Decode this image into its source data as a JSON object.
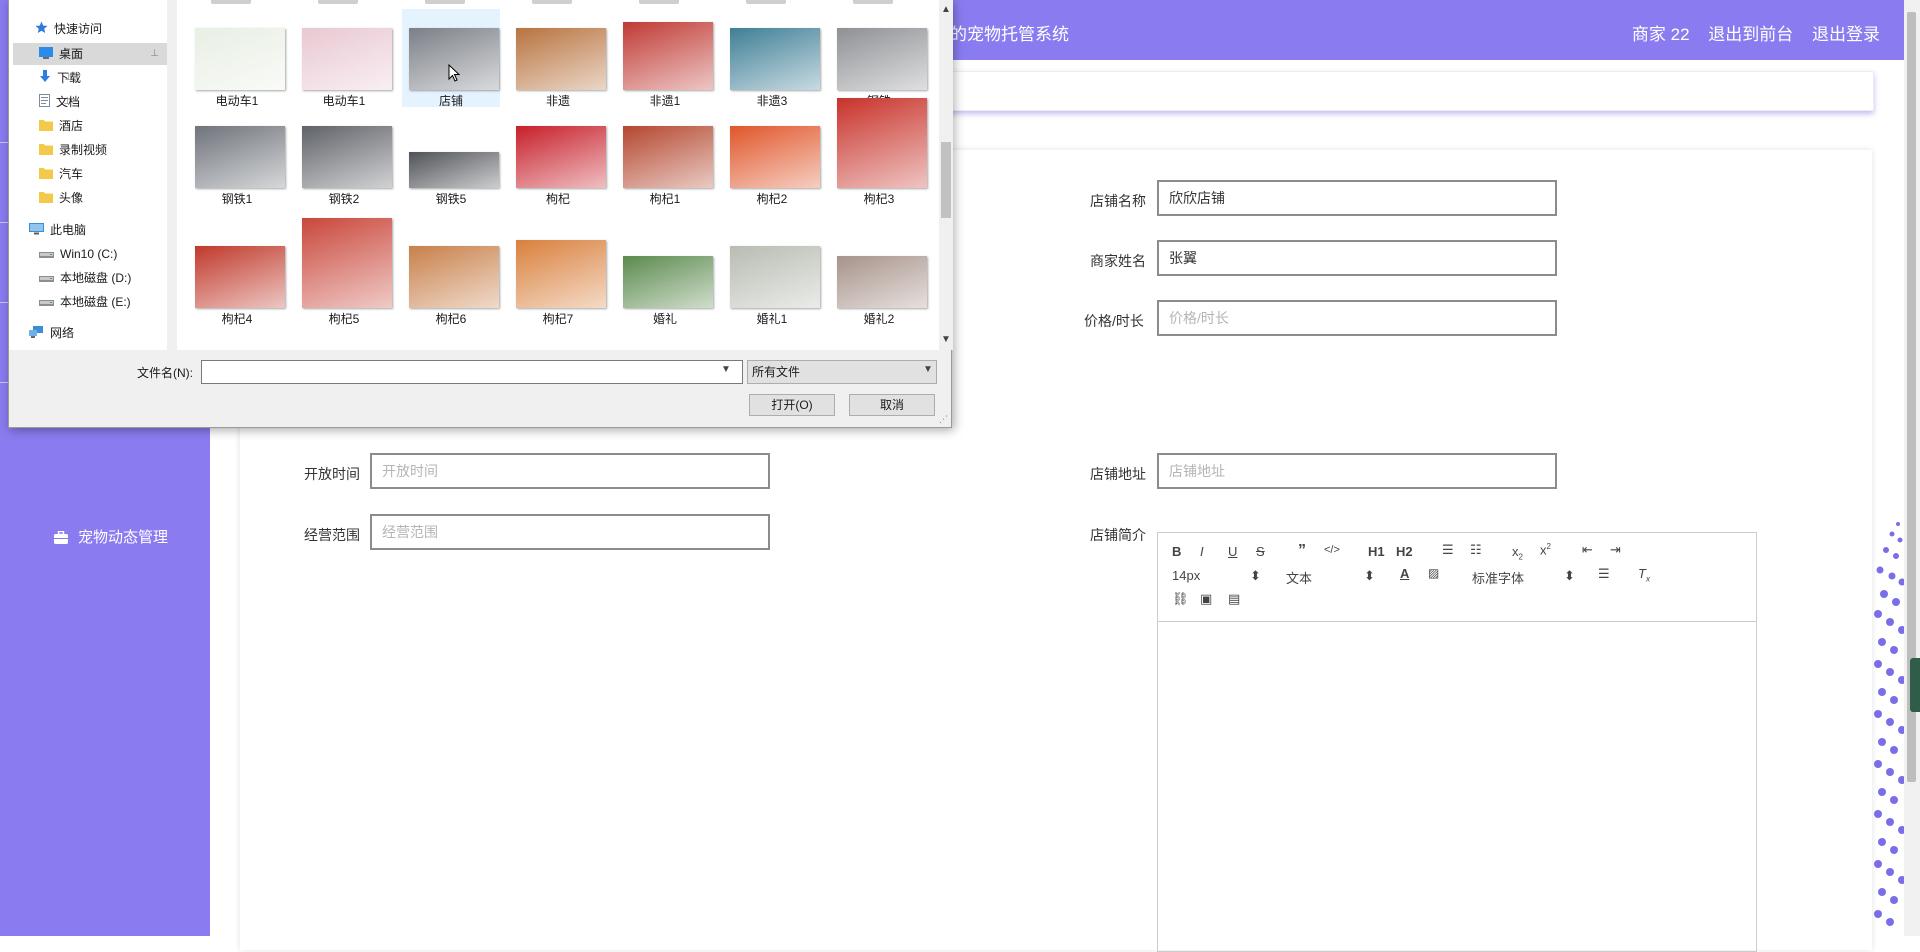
{
  "app": {
    "title": "的宠物托管系统",
    "user_label": "商家 22",
    "back_to_front": "退出到前台",
    "logout": "退出登录"
  },
  "sidebar": {
    "pet_news_item": "宠物动态管理"
  },
  "form": {
    "shop_name": {
      "label": "店铺名称",
      "value": "欣欣店铺"
    },
    "merchant_name": {
      "label": "商家姓名",
      "value": "张翼"
    },
    "price": {
      "label": "价格/时长",
      "placeholder": "价格/时长"
    },
    "open_time": {
      "label": "开放时间",
      "placeholder": "开放时间"
    },
    "address": {
      "label": "店铺地址",
      "placeholder": "店铺地址"
    },
    "scope": {
      "label": "经营范围",
      "placeholder": "经营范围"
    },
    "intro": {
      "label": "店铺简介"
    }
  },
  "editor": {
    "font_size": "14px",
    "header_select": "文本",
    "font_family": "标准字体",
    "h1": "H1",
    "h2": "H2"
  },
  "dialog": {
    "nav": [
      {
        "label": "快速访问",
        "icon": "star-icon"
      },
      {
        "label": "桌面",
        "icon": "desktop-icon",
        "pinned": true,
        "selected": true
      },
      {
        "label": "下载",
        "icon": "download-icon",
        "pinned": true
      },
      {
        "label": "文档",
        "icon": "document-icon",
        "pinned": true
      },
      {
        "label": "酒店",
        "icon": "folder-icon"
      },
      {
        "label": "录制视频",
        "icon": "folder-icon"
      },
      {
        "label": "汽车",
        "icon": "folder-icon"
      },
      {
        "label": "头像",
        "icon": "folder-icon"
      },
      {
        "label": "此电脑",
        "icon": "computer-icon"
      },
      {
        "label": "Win10 (C:)",
        "icon": "drive-icon"
      },
      {
        "label": "本地磁盘 (D:)",
        "icon": "drive-icon"
      },
      {
        "label": "本地磁盘 (E:)",
        "icon": "drive-icon"
      },
      {
        "label": "网络",
        "icon": "network-icon"
      }
    ],
    "files": [
      {
        "name": "电动车1",
        "color": "#e8efe4"
      },
      {
        "name": "电动车1",
        "color": "#e9c8d2"
      },
      {
        "name": "店铺",
        "color": "#7b7f86",
        "selected": true
      },
      {
        "name": "非遗",
        "color": "#b8733f"
      },
      {
        "name": "非遗1",
        "color": "#c03a34"
      },
      {
        "name": "非遗3",
        "color": "#3f7f96"
      },
      {
        "name": "钢铁",
        "color": "#8e9094"
      },
      {
        "name": "钢铁1",
        "color": "#6f747b"
      },
      {
        "name": "钢铁2",
        "color": "#5f6268"
      },
      {
        "name": "钢铁5",
        "color": "#4f5257"
      },
      {
        "name": "枸杞",
        "color": "#c71f2a"
      },
      {
        "name": "枸杞1",
        "color": "#b4472f"
      },
      {
        "name": "枸杞2",
        "color": "#e0562a"
      },
      {
        "name": "枸杞3",
        "color": "#c8322a"
      },
      {
        "name": "枸杞4",
        "color": "#c0392b"
      },
      {
        "name": "枸杞5",
        "color": "#c9473b"
      },
      {
        "name": "枸杞6",
        "color": "#c8804a"
      },
      {
        "name": "枸杞7",
        "color": "#d9803c"
      },
      {
        "name": "婚礼",
        "color": "#5b8a4e"
      },
      {
        "name": "婚礼1",
        "color": "#b8bcb2"
      },
      {
        "name": "婚礼2",
        "color": "#a7938a"
      }
    ],
    "filename_label": "文件名(N):",
    "filetype": "所有文件",
    "open_button": "打开(O)",
    "cancel_button": "取消"
  }
}
